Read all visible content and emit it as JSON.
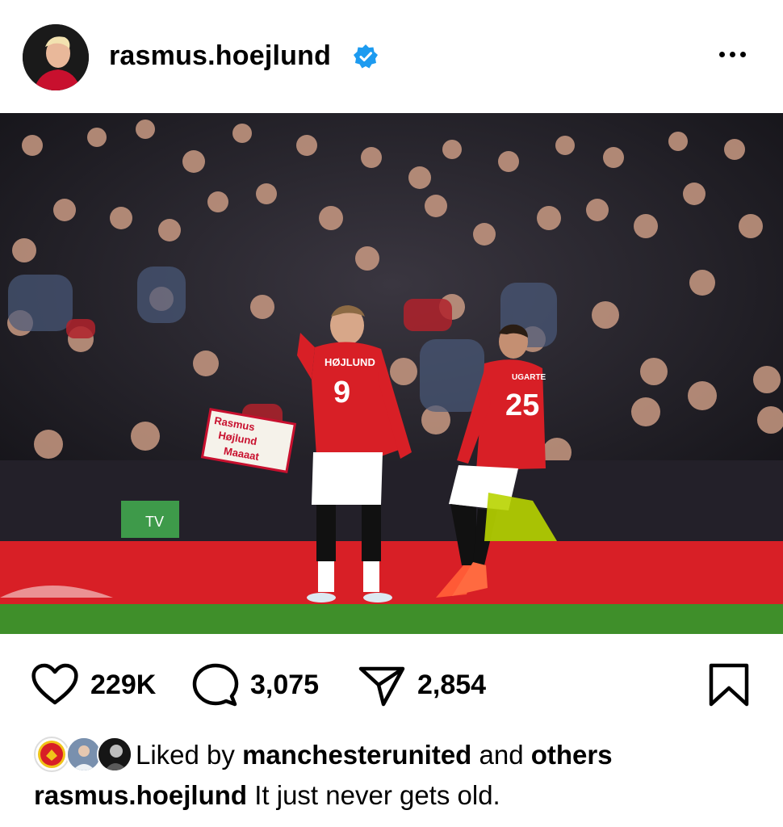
{
  "post": {
    "username": "rasmus.hoejlund",
    "verified": true,
    "more_icon": "more-horizontal-icon",
    "photo_alt": {
      "jersey_9_name": "HØJLUND",
      "jersey_9_number": "9",
      "jersey_25_name": "UGARTE",
      "jersey_25_number": "25",
      "banner_text_1": "Rasmus",
      "banner_text_2": "Højlund",
      "banner_text_3": "Maaaat",
      "board_text": "TV"
    },
    "stats": {
      "likes": "229K",
      "comments": "3,075",
      "shares": "2,854"
    },
    "liked_by": {
      "prefix": "Liked by",
      "user": "manchesterunited",
      "connector": "and",
      "others": "others"
    },
    "caption": {
      "username": "rasmus.hoejlund",
      "text": "It just never gets old."
    }
  },
  "colors": {
    "verified_badge": "#1d9bf0",
    "united_red": "#d81f26",
    "pitch_green": "#3f8f2a"
  }
}
